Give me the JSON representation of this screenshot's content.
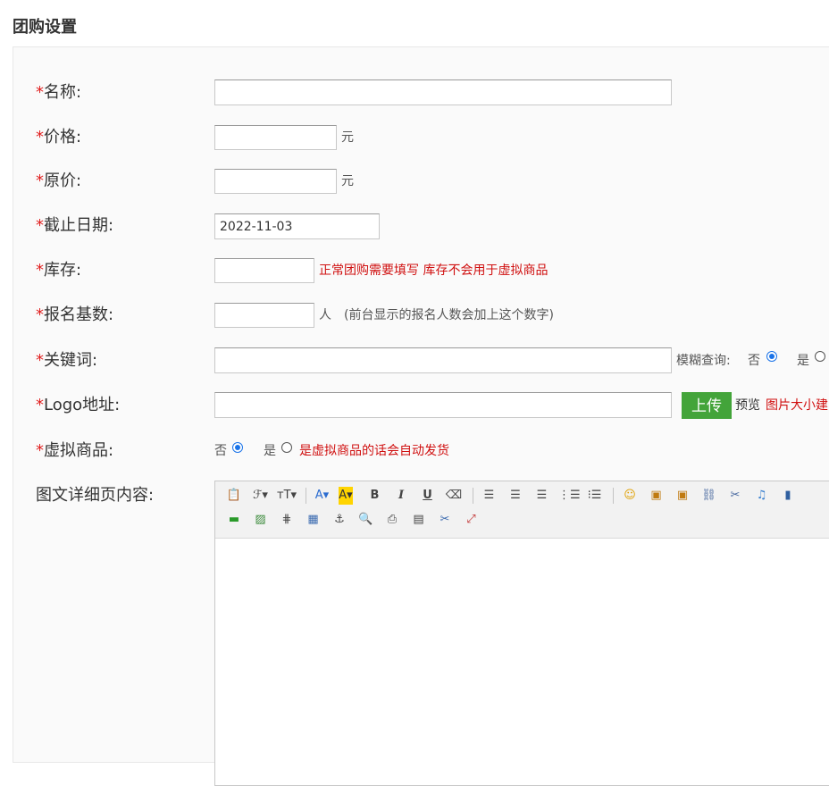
{
  "page": {
    "title": "团购设置"
  },
  "form": {
    "required_mark": "*",
    "name": {
      "label": "名称:",
      "value": ""
    },
    "price": {
      "label": "价格:",
      "value": "",
      "unit": "元"
    },
    "original_price": {
      "label": "原价:",
      "value": "",
      "unit": "元"
    },
    "deadline": {
      "label": "截止日期:",
      "value": "2022-11-03"
    },
    "stock": {
      "label": "库存:",
      "value": "",
      "hint": "正常团购需要填写 库存不会用于虚拟商品"
    },
    "signup_base": {
      "label": "报名基数:",
      "value": "",
      "unit": "人",
      "hint": "(前台显示的报名人数会加上这个数字)"
    },
    "keywords": {
      "label": "关键词:",
      "value": "",
      "fuzzy_label": "模糊查询:",
      "no_label": "否",
      "yes_label": "是",
      "selected": "否"
    },
    "logo": {
      "label": "Logo地址:",
      "value": "",
      "upload_label": "上传",
      "preview_label": "预览",
      "size_hint": "图片大小建"
    },
    "virtual": {
      "label": "虚拟商品:",
      "no_label": "否",
      "yes_label": "是",
      "selected": "否",
      "hint": "是虚拟商品的话会自动发货"
    },
    "content": {
      "label": "图文详细页内容:"
    }
  },
  "editor": {
    "toolbar_row1": [
      {
        "name": "paste-icon",
        "glyph": "📋"
      },
      {
        "name": "font-family-icon",
        "glyph": "ℱ▾"
      },
      {
        "name": "font-size-icon",
        "glyph": "тT▾"
      },
      {
        "name": "sep"
      },
      {
        "name": "font-color-icon",
        "glyph": "A▾"
      },
      {
        "name": "highlight-icon",
        "glyph": "A▾"
      },
      {
        "name": "bold-icon",
        "glyph": "B"
      },
      {
        "name": "italic-icon",
        "glyph": "I"
      },
      {
        "name": "underline-icon",
        "glyph": "U"
      },
      {
        "name": "eraser-icon",
        "glyph": "⌫"
      },
      {
        "name": "sep"
      },
      {
        "name": "align-left-icon",
        "glyph": "☰"
      },
      {
        "name": "align-center-icon",
        "glyph": "☰"
      },
      {
        "name": "align-right-icon",
        "glyph": "☰"
      },
      {
        "name": "ordered-list-icon",
        "glyph": "⋮☰"
      },
      {
        "name": "unordered-list-icon",
        "glyph": "⁝☰"
      },
      {
        "name": "sep"
      },
      {
        "name": "emoticon-icon",
        "glyph": "☺"
      },
      {
        "name": "image-icon",
        "glyph": "▣"
      },
      {
        "name": "multi-image-icon",
        "glyph": "▣"
      },
      {
        "name": "link-icon",
        "glyph": "⛓"
      },
      {
        "name": "unlink-icon",
        "glyph": "✂"
      },
      {
        "name": "music-icon",
        "glyph": "♫"
      },
      {
        "name": "video-icon",
        "glyph": "▮"
      }
    ],
    "toolbar_row2": [
      {
        "name": "hr-icon",
        "glyph": "▬"
      },
      {
        "name": "picture-icon",
        "glyph": "▨"
      },
      {
        "name": "grid-icon",
        "glyph": "⋕"
      },
      {
        "name": "table-icon",
        "glyph": "▦"
      },
      {
        "name": "anchor-icon",
        "glyph": "⚓"
      },
      {
        "name": "preview-icon",
        "glyph": "🔍"
      },
      {
        "name": "print-icon",
        "glyph": "⎙"
      },
      {
        "name": "template-icon",
        "glyph": "▤"
      },
      {
        "name": "cut-icon",
        "glyph": "✂"
      },
      {
        "name": "fullscreen-icon",
        "glyph": "⤢"
      }
    ],
    "colors": {
      "accent": "#1a73e8",
      "upload_green": "#43a43a",
      "hint_red": "#d01010"
    }
  }
}
